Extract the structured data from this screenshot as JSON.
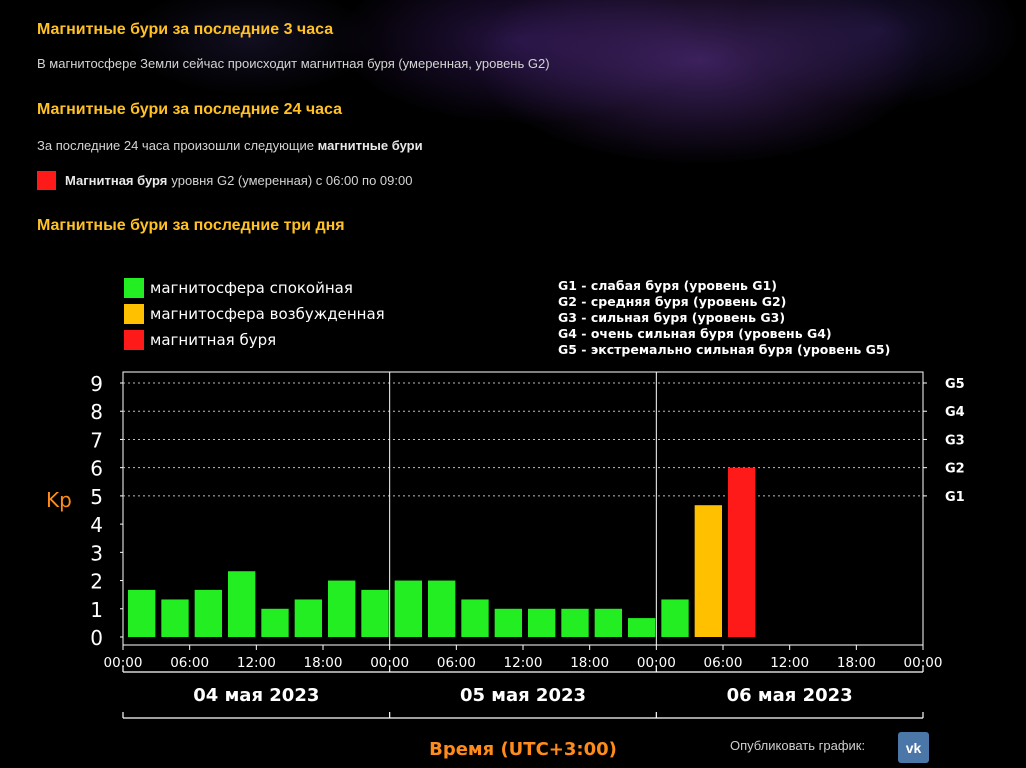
{
  "section1": {
    "heading": "Магнитные бури за последние 3 часа",
    "text": "В магнитосфере Земли сейчас происходит магнитная буря (умеренная, уровень G2)"
  },
  "section2": {
    "heading": "Магнитные бури за последние 24 часа",
    "text_plain": "За последние 24 часа произошли следующие ",
    "text_bold": "магнитные бури",
    "storm_bold": "Магнитная буря",
    "storm_text": "уровня G2 (умеренная) с 06:00 по 09:00",
    "storm_color": "#ff1a1a"
  },
  "section3": {
    "heading": "Магнитные бури за последние три дня"
  },
  "chart_data": {
    "type": "bar",
    "ylabel": "Kp",
    "xlabel": "Время (UTC+3:00)",
    "ylim": [
      0,
      9
    ],
    "yticks": [
      "0",
      "1",
      "2",
      "3",
      "4",
      "5",
      "6",
      "7",
      "8",
      "9"
    ],
    "g_ticks": [
      {
        "label": "G1",
        "value": 5
      },
      {
        "label": "G2",
        "value": 6
      },
      {
        "label": "G3",
        "value": 7
      },
      {
        "label": "G4",
        "value": 8
      },
      {
        "label": "G5",
        "value": 9
      }
    ],
    "xticks": [
      "00:00",
      "06:00",
      "12:00",
      "18:00",
      "00:00",
      "06:00",
      "12:00",
      "18:00",
      "00:00",
      "06:00",
      "12:00",
      "18:00",
      "00:00"
    ],
    "days": [
      "04 мая 2023",
      "05 мая 2023",
      "06 мая 2023"
    ],
    "legend": [
      {
        "label": "магнитосфера спокойная",
        "color": "#22ee22"
      },
      {
        "label": "магнитосфера возбужденная",
        "color": "#ffc000"
      },
      {
        "label": "магнитная буря",
        "color": "#ff1a1a"
      }
    ],
    "g_legend": [
      "G1 - слабая буря (уровень G1)",
      "G2 - средняя буря (уровень G2)",
      "G3 - сильная буря (уровень G3)",
      "G4 - очень сильная буря (уровень G4)",
      "G5 - экстремально сильная буря (уровень G5)"
    ],
    "interval_hours": 3,
    "values": [
      1.67,
      1.33,
      1.67,
      2.33,
      1.0,
      1.33,
      2.0,
      1.67,
      2.0,
      2.0,
      1.33,
      1.0,
      1.0,
      1.0,
      1.0,
      0.67,
      1.33,
      4.67,
      6.0
    ],
    "levels": [
      "quiet",
      "quiet",
      "quiet",
      "quiet",
      "quiet",
      "quiet",
      "quiet",
      "quiet",
      "quiet",
      "quiet",
      "quiet",
      "quiet",
      "quiet",
      "quiet",
      "quiet",
      "quiet",
      "quiet",
      "active",
      "storm"
    ],
    "colors": {
      "quiet": "#22ee22",
      "active": "#ffc000",
      "storm": "#ff1a1a"
    },
    "grid_dotted_at": [
      5,
      6,
      7,
      8,
      9
    ]
  },
  "footer": {
    "publish_label": "Опубликовать график:",
    "vk_icon": "vk-icon",
    "vk_text": "vk"
  }
}
